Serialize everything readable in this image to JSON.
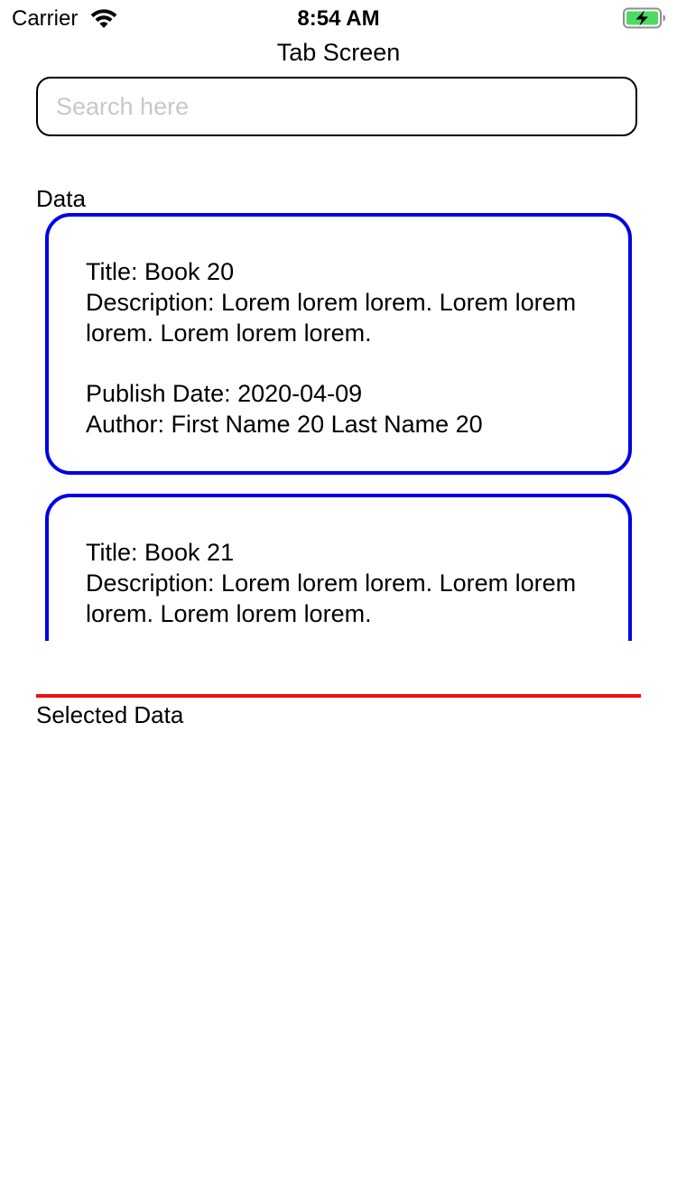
{
  "status_bar": {
    "carrier": "Carrier",
    "time": "8:54 AM",
    "icons": [
      "wifi-icon",
      "battery-charging-icon"
    ]
  },
  "header": {
    "title": "Tab Screen"
  },
  "search": {
    "placeholder": "Search here",
    "value": ""
  },
  "data_section": {
    "label": "Data",
    "books": [
      {
        "title": "Title: Book 20",
        "description": "Description: Lorem lorem lorem. Lorem lorem lorem. Lorem lorem lorem.",
        "publish_date": "Publish Date: 2020-04-09",
        "author": "Author: First Name 20 Last Name 20"
      },
      {
        "title": "Title: Book 21",
        "description": "Description: Lorem lorem lorem. Lorem lorem lorem. Lorem lorem lorem."
      }
    ]
  },
  "selected_section": {
    "label": "Selected Data"
  },
  "colors": {
    "card_border": "#0000e6",
    "divider": "#ee1111",
    "battery_fill": "#4cd964",
    "placeholder": "#c7c7cd"
  }
}
